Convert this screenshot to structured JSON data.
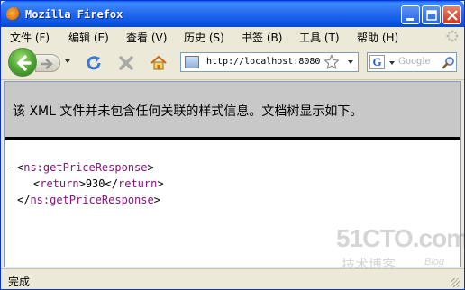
{
  "window": {
    "title": "Mozilla Firefox"
  },
  "menubar": {
    "items": [
      "文件 (F)",
      "编辑 (E)",
      "查看 (V)",
      "历史 (S)",
      "书签 (B)",
      "工具 (T)",
      "帮助 (H)"
    ]
  },
  "navbar": {
    "url": "http://localhost:8080",
    "search_placeholder": "Google",
    "search_engine": "G"
  },
  "content": {
    "notice": "该 XML 文件并未包含任何关联的样式信息。文档树显示如下。",
    "collapse_marker": "-",
    "xml": {
      "root_tag": "ns:getPriceResponse",
      "child_tag": "return",
      "child_value": "930"
    }
  },
  "watermark": {
    "brand": "51CTO.com",
    "subtitle": "技术博客",
    "blog": "Blog"
  },
  "status": {
    "text": "完成"
  },
  "colors": {
    "title_bar": "#2a6ef0",
    "xml_tag": "#881280",
    "notice_bg": "#c8c8c8"
  }
}
